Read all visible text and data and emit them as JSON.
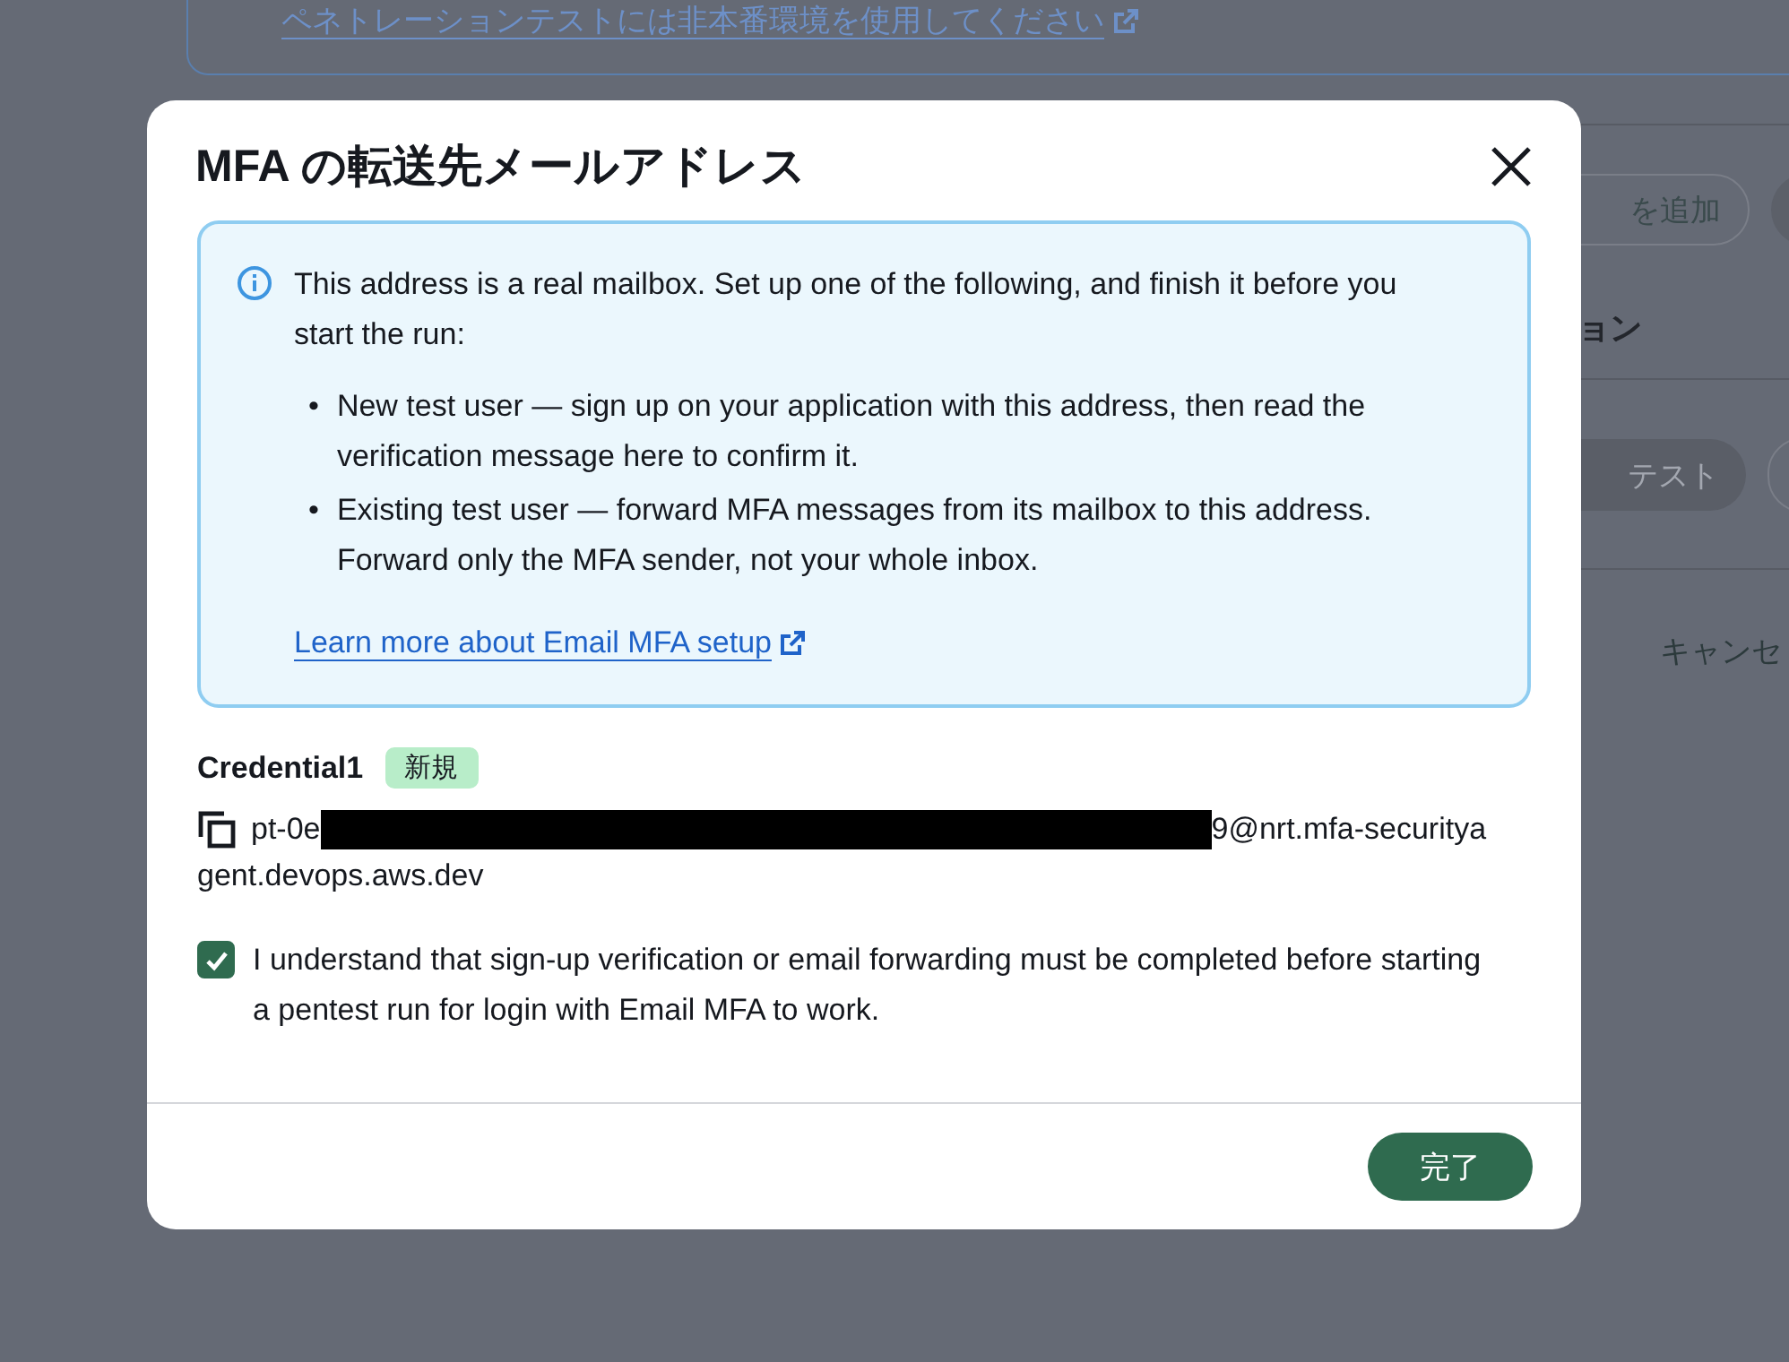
{
  "background": {
    "link": "ペネトレーションテストには非本番環境を使用してください",
    "add_button": "を追加",
    "section_heading": "ョン",
    "test_button": "テスト",
    "cancel_text": "キャンセ"
  },
  "dialog": {
    "title": "MFA の転送先メールアドレス",
    "info": {
      "text": "This address is a real mailbox. Set up one of the following, and finish it before you start the run:",
      "bullets": [
        {
          "marker": "•",
          "text": "New test user — sign up on your application with this address, then read the verification message here to confirm it."
        },
        {
          "marker": "•",
          "text": "Existing test user — forward MFA messages from its mailbox to this address. Forward only the MFA sender, not your whole inbox."
        }
      ],
      "link": "Learn more about Email MFA setup"
    },
    "credential": {
      "name": "Credential1",
      "badge": "新規",
      "email_start": "pt-0e",
      "email_end_line1": "9@nrt.mfa-securitya",
      "email_end_line2": "gent.devops.aws.dev"
    },
    "confirm": {
      "checked": true,
      "label": "I understand that sign-up verification or email forwarding must be completed before starting a pentest run for login with Email MFA to work."
    },
    "done_button": "完了"
  }
}
